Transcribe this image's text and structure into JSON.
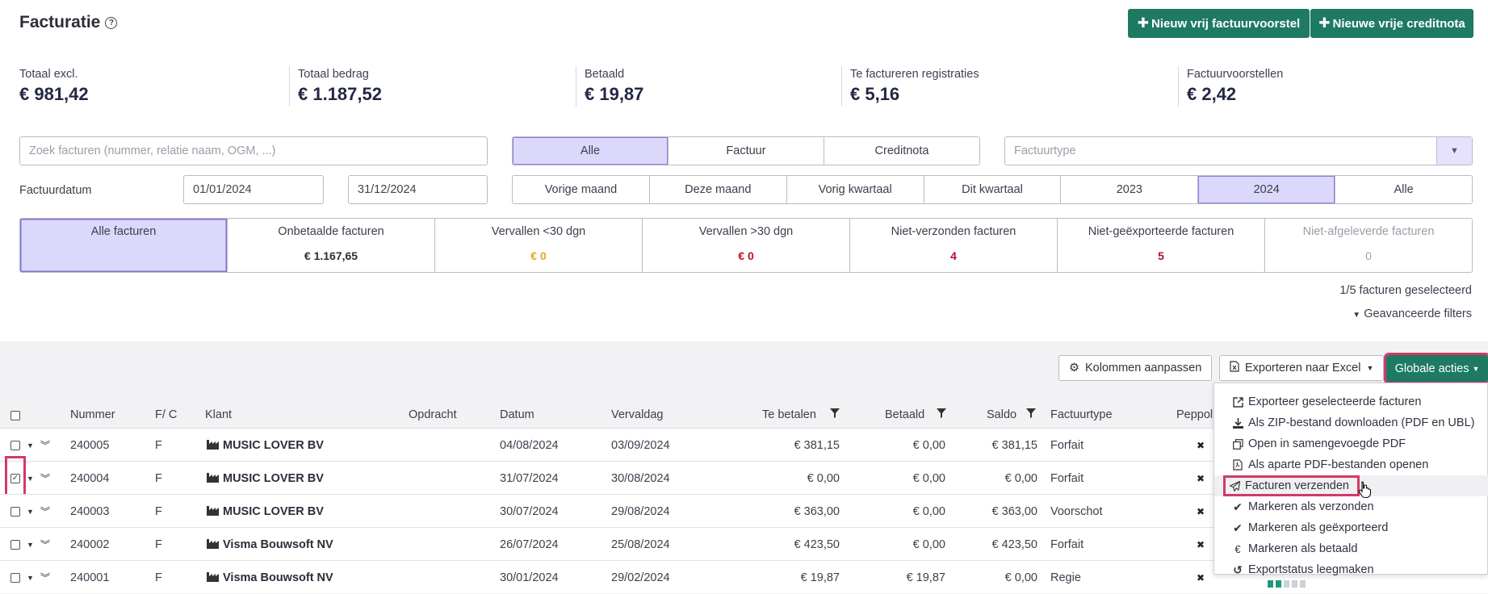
{
  "header": {
    "title": "Facturatie",
    "new_proposal_label": "Nieuw vrij factuurvoorstel",
    "new_credit_label": "Nieuwe vrije creditnota"
  },
  "totals": [
    {
      "label": "Totaal excl.",
      "value": "€ 981,42"
    },
    {
      "label": "Totaal bedrag",
      "value": "€ 1.187,52"
    },
    {
      "label": "Betaald",
      "value": "€ 19,87"
    },
    {
      "label": "Te factureren registraties",
      "value": "€ 5,16"
    },
    {
      "label": "Factuurvoorstellen",
      "value": "€ 2,42"
    }
  ],
  "filters": {
    "search_placeholder": "Zoek facturen (nummer, relatie naam, OGM, ...)",
    "doc_types": [
      "Alle",
      "Factuur",
      "Creditnota"
    ],
    "doc_type_selected": "Alle",
    "invoice_type_placeholder": "Factuurtype",
    "date_label": "Factuurdatum",
    "date_from": "01/01/2024",
    "date_to": "31/12/2024",
    "periods": [
      "Vorige maand",
      "Deze maand",
      "Vorig kwartaal",
      "Dit kwartaal",
      "2023",
      "2024",
      "Alle"
    ],
    "period_selected": "2024"
  },
  "status_tiles": [
    {
      "label": "Alle facturen",
      "value": "",
      "color": "#3a3f4b"
    },
    {
      "label": "Onbetaalde facturen",
      "value": "€ 1.167,65",
      "color": "#2b2e3a"
    },
    {
      "label": "Vervallen <30 dgn",
      "value": "€ 0",
      "color": "#e8a21c"
    },
    {
      "label": "Vervallen >30 dgn",
      "value": "€ 0",
      "color": "#c0121f"
    },
    {
      "label": "Niet-verzonden facturen",
      "value": "4",
      "color": "#b0102a"
    },
    {
      "label": "Niet-geëxporteerde facturen",
      "value": "5",
      "color": "#b0102a"
    },
    {
      "label": "Niet-afgeleverde facturen",
      "value": "0",
      "color": "#9a9ea8"
    }
  ],
  "selection_text": "1/5 facturen geselecteerd",
  "advanced_filters_label": "Geavanceerde filters",
  "toolbar": {
    "columns_label": "Kolommen aanpassen",
    "export_excel_label": "Exporteren naar Excel",
    "global_actions_label": "Globale acties"
  },
  "table": {
    "headers": {
      "number": "Nummer",
      "fc": "F/ C",
      "client": "Klant",
      "order": "Opdracht",
      "date": "Datum",
      "due": "Vervaldag",
      "to_pay": "Te betalen",
      "paid": "Betaald",
      "balance": "Saldo",
      "type": "Factuurtype",
      "peppol": "Peppol"
    },
    "rows": [
      {
        "number": "240005",
        "fc": "F",
        "client": "MUSIC LOVER BV",
        "date": "04/08/2024",
        "due": "03/09/2024",
        "to_pay": "€ 381,15",
        "paid": "€ 0,00",
        "balance": "€ 381,15",
        "type": "Forfait",
        "peppol": "✖",
        "checked": false
      },
      {
        "number": "240004",
        "fc": "F",
        "client": "MUSIC LOVER BV",
        "date": "31/07/2024",
        "due": "30/08/2024",
        "to_pay": "€ 0,00",
        "paid": "€ 0,00",
        "balance": "€ 0,00",
        "type": "Forfait",
        "peppol": "✖",
        "checked": true
      },
      {
        "number": "240003",
        "fc": "F",
        "client": "MUSIC LOVER BV",
        "date": "30/07/2024",
        "due": "29/08/2024",
        "to_pay": "€ 363,00",
        "paid": "€ 0,00",
        "balance": "€ 363,00",
        "type": "Voorschot",
        "peppol": "✖",
        "checked": false
      },
      {
        "number": "240002",
        "fc": "F",
        "client": "Visma Bouwsoft NV",
        "date": "26/07/2024",
        "due": "25/08/2024",
        "to_pay": "€ 423,50",
        "paid": "€ 0,00",
        "balance": "€ 423,50",
        "type": "Forfait",
        "peppol": "✖",
        "checked": false
      },
      {
        "number": "240001",
        "fc": "F",
        "client": "Visma Bouwsoft NV",
        "date": "30/01/2024",
        "due": "29/02/2024",
        "to_pay": "€ 19,87",
        "paid": "€ 19,87",
        "balance": "€ 0,00",
        "type": "Regie",
        "peppol": "✖",
        "checked": false
      }
    ]
  },
  "global_actions_menu": [
    {
      "label": "Exporteer geselecteerde facturen",
      "icon": "external-link-icon"
    },
    {
      "label": "Als ZIP-bestand downloaden (PDF en UBL)",
      "icon": "download-icon"
    },
    {
      "label": "Open in samengevoegde PDF",
      "icon": "copy-icon"
    },
    {
      "label": "Als aparte PDF-bestanden openen",
      "icon": "file-pdf-icon"
    },
    {
      "label": "Facturen verzenden",
      "icon": "paper-plane-icon"
    },
    {
      "label": "Markeren als verzonden",
      "icon": "check-icon"
    },
    {
      "label": "Markeren als geëxporteerd",
      "icon": "check-icon"
    },
    {
      "label": "Markeren als betaald",
      "icon": "euro-icon"
    },
    {
      "label": "Exportstatus leegmaken",
      "icon": "undo-icon"
    }
  ],
  "colors": {
    "brand_green": "#1e7a63",
    "highlight": "#d23a67",
    "selected_bg": "#dcd8fb"
  }
}
